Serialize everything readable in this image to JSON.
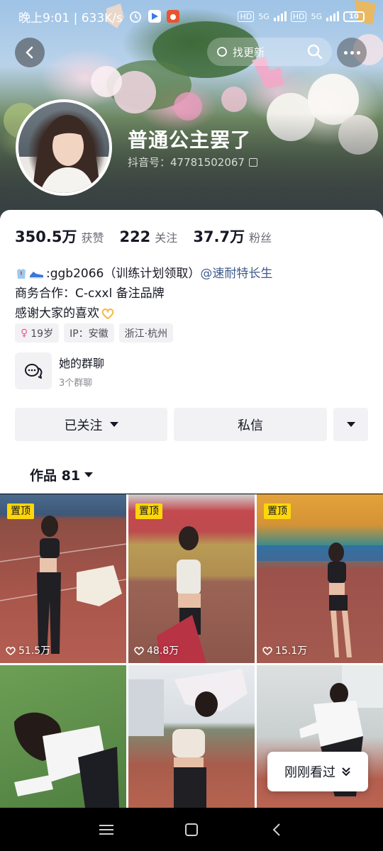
{
  "status_bar": {
    "time_speed": "晚上9:01 | 633K/s",
    "battery": "10",
    "net1": "5G",
    "net2": "5G",
    "hd": "HD"
  },
  "header": {
    "search_text": "找更新"
  },
  "profile": {
    "nickname": "普通公主罢了",
    "douyin_id": "抖音号：47781502067"
  },
  "stats": [
    {
      "num": "350.5万",
      "label": "获赞"
    },
    {
      "num": "222",
      "label": "关注"
    },
    {
      "num": "37.7万",
      "label": "粉丝"
    }
  ],
  "bio": {
    "line1_text": ":ggb2066（训练计划领取）",
    "line1_mention": "@速耐特长生",
    "line2": "商务合作：C-cxxl 备注品牌",
    "line3": "感谢大家的喜欢"
  },
  "tags": [
    {
      "text": "19岁",
      "icon": "female-icon"
    },
    {
      "text": "IP：安徽"
    },
    {
      "text": "浙江·杭州"
    }
  ],
  "group_chat": {
    "title": "她的群聊",
    "subtitle": "3个群聊"
  },
  "actions": {
    "followed": "已关注",
    "message": "私信"
  },
  "works_tab": "作品 81",
  "grid": [
    {
      "pinned": true,
      "pin_label": "置顶",
      "likes": "51.5万"
    },
    {
      "pinned": true,
      "pin_label": "置顶",
      "likes": "48.8万"
    },
    {
      "pinned": true,
      "pin_label": "置顶",
      "likes": "15.1万"
    },
    {
      "pinned": false,
      "likes": ""
    },
    {
      "pinned": false,
      "likes": ""
    },
    {
      "pinned": false,
      "likes": ""
    }
  ],
  "just_seen": "刚刚看过",
  "colors": {
    "mention": "#3d5a8a",
    "pin_bg": "#ffd60a",
    "button_bg": "#f2f2f4"
  }
}
